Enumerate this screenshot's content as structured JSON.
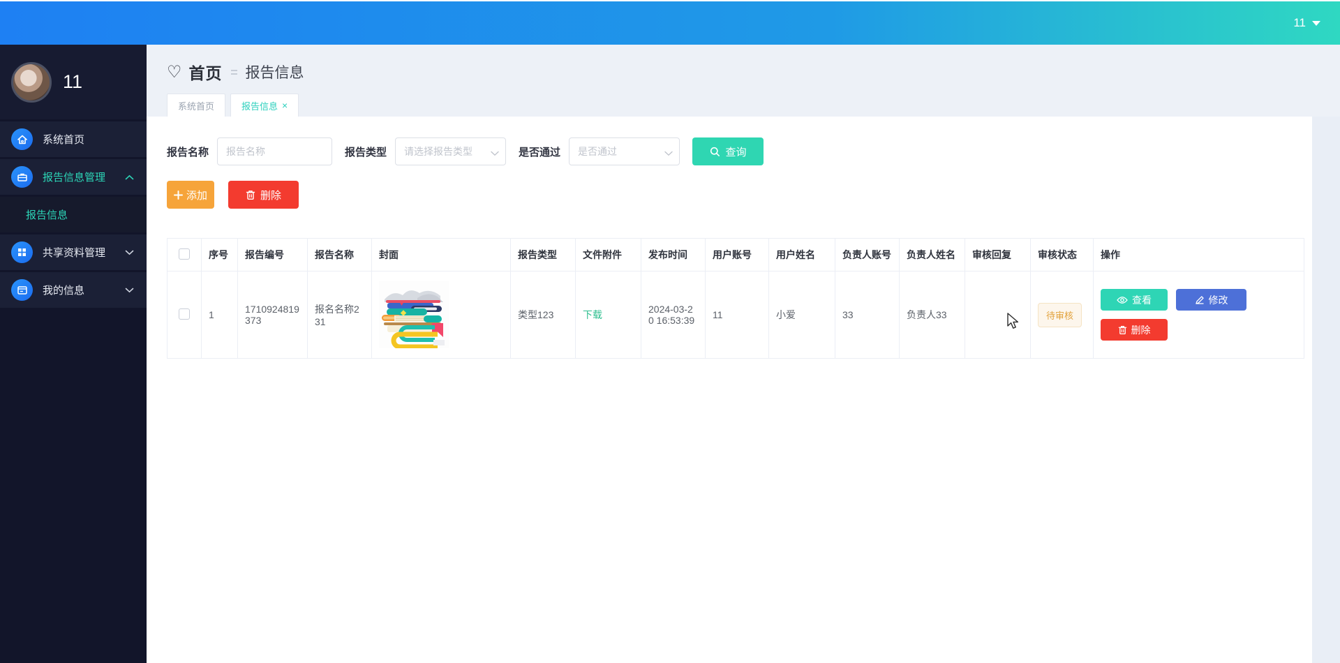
{
  "topbar": {
    "user": "11"
  },
  "sidebar": {
    "username": "11",
    "items": [
      {
        "label": "系统首页"
      },
      {
        "label": "报告信息管理"
      },
      {
        "label": "报告信息"
      },
      {
        "label": "共享资料管理"
      },
      {
        "label": "我的信息"
      }
    ]
  },
  "breadcrumb": {
    "home": "首页",
    "current": "报告信息"
  },
  "tabs": [
    {
      "label": "系统首页"
    },
    {
      "label": "报告信息",
      "close": "×"
    }
  ],
  "filters": {
    "name_label": "报告名称",
    "name_placeholder": "报告名称",
    "type_label": "报告类型",
    "type_placeholder": "请选择报告类型",
    "pass_label": "是否通过",
    "pass_placeholder": "是否通过",
    "search_label": "查询"
  },
  "toolbar": {
    "add_label": "添加",
    "delete_label": "删除"
  },
  "table": {
    "headers": {
      "index": "序号",
      "report_no": "报告编号",
      "report_name": "报告名称",
      "cover": "封面",
      "report_type": "报告类型",
      "attachment": "文件附件",
      "publish_time": "发布时间",
      "user_account": "用户账号",
      "user_name": "用户姓名",
      "manager_account": "负责人账号",
      "manager_name": "负责人姓名",
      "review_reply": "审核回复",
      "review_status": "审核状态",
      "ops": "操作"
    },
    "rows": [
      {
        "index": "1",
        "report_no": "1710924819373",
        "report_name": "报名名称231",
        "report_type": "类型123",
        "attachment": "下载",
        "publish_time": "2024-03-20 16:53:39",
        "user_account": "11",
        "user_name": "小爱",
        "manager_account": "33",
        "manager_name": "负责人33",
        "review_reply": "",
        "review_status": "待审核",
        "ops": {
          "view": "查看",
          "edit": "修改",
          "delete": "删除"
        }
      }
    ]
  },
  "colors": {
    "topbar_gradient_start": "#1e80f3",
    "topbar_gradient_end": "#2fd8c2",
    "sidebar_bg": "#12152a",
    "menu_active_text": "#2cd5b7",
    "search_button": "#2fd6b2",
    "add_button": "#f6a43a",
    "delete_button": "#f33b2f",
    "edit_button": "#4d70d8",
    "view_button": "#2ed5b5",
    "download_link": "#2fbf8f",
    "pending_tag_text": "#e2a23c",
    "pending_tag_bg": "#fdf6ec"
  }
}
